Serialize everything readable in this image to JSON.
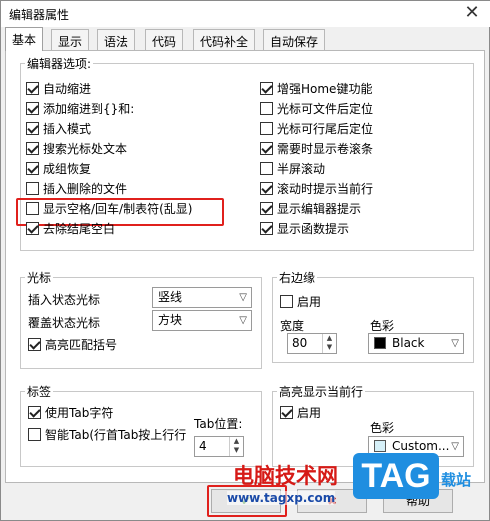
{
  "window": {
    "title": "编辑器属性",
    "close_glyph": "✕"
  },
  "tabs": [
    {
      "label": "基本"
    },
    {
      "label": "显示"
    },
    {
      "label": "语法"
    },
    {
      "label": "代码"
    },
    {
      "label": "代码补全"
    },
    {
      "label": "自动保存"
    }
  ],
  "editor_options": {
    "legend": "编辑器选项:",
    "left": [
      {
        "label": "自动缩进",
        "checked": true
      },
      {
        "label": "添加缩进到{}和:",
        "checked": true
      },
      {
        "label": "插入模式",
        "checked": true
      },
      {
        "label": "搜索光标处文本",
        "checked": true
      },
      {
        "label": "成组恢复",
        "checked": true
      },
      {
        "label": "插入删除的文件",
        "checked": false
      },
      {
        "label": "显示空格/回车/制表符(乱显)",
        "checked": false
      },
      {
        "label": "去除结尾空白",
        "checked": true
      }
    ],
    "right": [
      {
        "label": "增强Home键功能",
        "checked": true
      },
      {
        "label": "光标可文件后定位",
        "checked": false
      },
      {
        "label": "光标可行尾后定位",
        "checked": false
      },
      {
        "label": "需要时显示卷滚条",
        "checked": true
      },
      {
        "label": "半屏滚动",
        "checked": false
      },
      {
        "label": "滚动时提示当前行",
        "checked": true
      },
      {
        "label": "显示编辑器提示",
        "checked": true
      },
      {
        "label": "显示函数提示",
        "checked": true
      }
    ]
  },
  "cursor": {
    "legend": "光标",
    "insert_label": "插入状态光标",
    "insert_value": "竖线",
    "overwrite_label": "覆盖状态光标",
    "overwrite_value": "方块",
    "highlight_label": "高亮匹配括号",
    "highlight_checked": true
  },
  "right_margin": {
    "legend": "右边缘",
    "enable_label": "启用",
    "enable_checked": false,
    "width_label": "宽度",
    "width_value": "80",
    "color_label": "色彩",
    "color_value": "Black",
    "color_hex": "#000000"
  },
  "tab_group": {
    "legend": "标签",
    "use_tab_label": "使用Tab字符",
    "use_tab_checked": true,
    "smart_tab_label": "智能Tab(行首Tab按上行行",
    "smart_tab_checked": false,
    "pos_label": "Tab位置:",
    "pos_value": "4"
  },
  "highlight_line": {
    "legend": "高亮显示当前行",
    "enable_label": "启用",
    "enable_checked": true,
    "color_label": "色彩",
    "color_value": "Custom...",
    "color_hex": "#d6f0f8"
  },
  "buttons": {
    "ok_glyph": "✔",
    "cancel_glyph": "✖",
    "help_label": "帮助"
  },
  "watermark": {
    "site_name": "电脑技术网",
    "url": "www.tagxp.com",
    "logo": "TAG",
    "logo_suffix": "载站"
  },
  "colors": {
    "highlight_red": "#e0201c",
    "watermark_blue": "#1f8ee0"
  }
}
